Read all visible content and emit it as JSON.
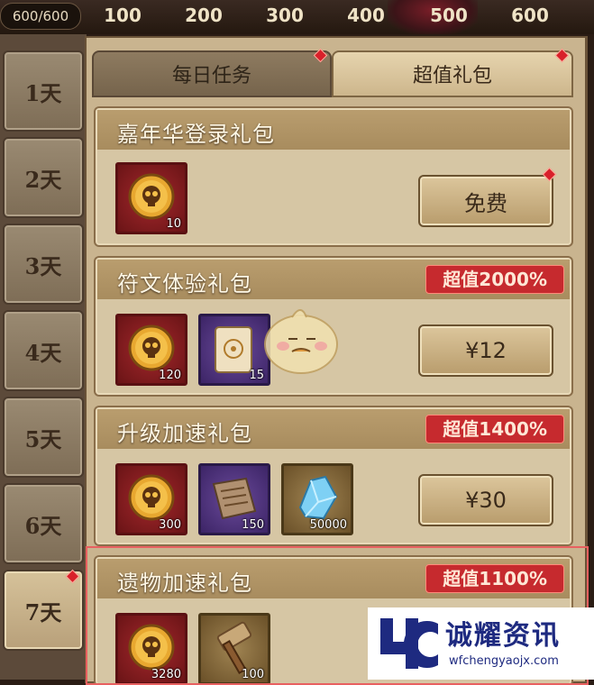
{
  "top": {
    "count": "600/600",
    "milestones": [
      "100",
      "200",
      "300",
      "400",
      "500",
      "600"
    ]
  },
  "days": [
    {
      "label": "1天",
      "active": false
    },
    {
      "label": "2天",
      "active": false
    },
    {
      "label": "3天",
      "active": false
    },
    {
      "label": "4天",
      "active": false
    },
    {
      "label": "5天",
      "active": false
    },
    {
      "label": "6天",
      "active": false
    },
    {
      "label": "7天",
      "active": true
    }
  ],
  "tabs": {
    "daily": "每日任务",
    "value": "超值礼包"
  },
  "packs": [
    {
      "title": "嘉年华登录礼包",
      "badge": "",
      "button": "免费",
      "items": [
        {
          "kind": "skull-coin-icon",
          "qty": "10"
        }
      ]
    },
    {
      "title": "符文体验礼包",
      "badge": "超值2000%",
      "button": "¥12",
      "items": [
        {
          "kind": "skull-coin-icon",
          "qty": "120"
        },
        {
          "kind": "rune-scroll-icon",
          "qty": "15"
        }
      ]
    },
    {
      "title": "升级加速礼包",
      "badge": "超值1400%",
      "button": "¥30",
      "items": [
        {
          "kind": "skull-coin-icon",
          "qty": "300"
        },
        {
          "kind": "parchment-icon",
          "qty": "150"
        },
        {
          "kind": "crystal-icon",
          "qty": "50000"
        }
      ]
    },
    {
      "title": "遗物加速礼包",
      "badge": "超值1100%",
      "button": "",
      "items": [
        {
          "kind": "skull-coin-icon",
          "qty": "3280"
        },
        {
          "kind": "hammer-icon",
          "qty": "100"
        }
      ]
    }
  ],
  "watermark": {
    "brand": "诚耀资讯",
    "url": "wfchengyaojx.com"
  },
  "colors": {
    "accent_red": "#c62a2e",
    "panel": "#c9b48f"
  }
}
